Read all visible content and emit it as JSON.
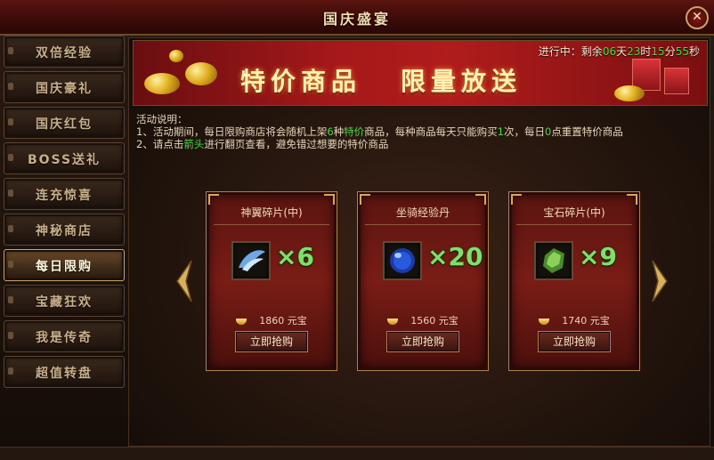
{
  "window": {
    "title": "国庆盛宴",
    "close_label": "✕"
  },
  "sidebar": {
    "items": [
      {
        "label": "双倍经验"
      },
      {
        "label": "国庆豪礼"
      },
      {
        "label": "国庆红包"
      },
      {
        "label": "BOSS送礼"
      },
      {
        "label": "连充惊喜"
      },
      {
        "label": "神秘商店"
      },
      {
        "label": "每日限购",
        "active": true
      },
      {
        "label": "宝藏狂欢"
      },
      {
        "label": "我是传奇"
      },
      {
        "label": "超值转盘"
      }
    ]
  },
  "banner": {
    "title_left": "特价商品",
    "title_right": "限量放送",
    "countdown": {
      "prefix": "进行中：剩余",
      "days": "06",
      "days_unit": "天",
      "hours": "23",
      "hours_unit": "时",
      "minutes": "15",
      "minutes_unit": "分",
      "seconds": "55",
      "seconds_unit": "秒"
    }
  },
  "description": {
    "heading": "活动说明：",
    "line1_a": "1、活动期间，每日限购商店将会随机上架",
    "line1_num": "6",
    "line1_b": "种",
    "line1_hl": "特价",
    "line1_c": "商品，每种商品每天只能购买",
    "line1_num2": "1",
    "line1_d": "次，每日",
    "line1_num3": "0",
    "line1_e": "点重置特价商品",
    "line2_a": "2、请点击",
    "line2_hl": "箭头",
    "line2_b": "进行翻页查看，避免错过想要的特价商品"
  },
  "products": [
    {
      "name": "神翼碎片(中)",
      "qty": "×6",
      "price": "1860",
      "currency": "元宝",
      "button": "立即抢购",
      "icon": "wing-fragment-icon",
      "icon_color": "#7ab8ff"
    },
    {
      "name": "坐骑经验丹",
      "qty": "×20",
      "price": "1560",
      "currency": "元宝",
      "button": "立即抢购",
      "icon": "blue-orb-icon",
      "icon_color": "#2a5adc"
    },
    {
      "name": "宝石碎片(中)",
      "qty": "×9",
      "price": "1740",
      "currency": "元宝",
      "button": "立即抢购",
      "icon": "green-gem-icon",
      "icon_color": "#6ab04a"
    }
  ],
  "nav": {
    "prev_icon": "left-arrow-icon",
    "next_icon": "right-arrow-icon"
  },
  "colors": {
    "highlight_green": "#4ad84a",
    "qty_green": "#7ee06a",
    "gold_border": "#b08050"
  }
}
